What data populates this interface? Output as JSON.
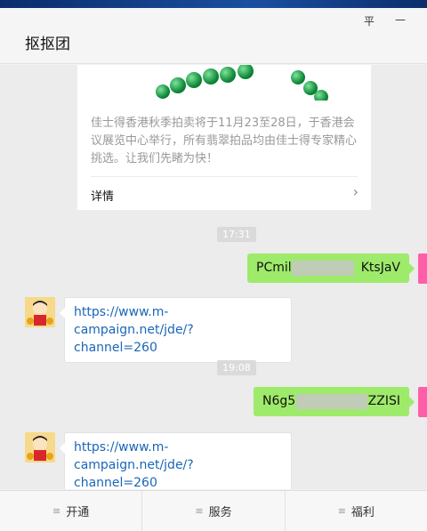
{
  "window": {
    "title": "抠抠团",
    "controls": {
      "pin": "平",
      "minimize": "—"
    }
  },
  "card": {
    "description": "佳士得香港秋季拍卖将于11月23至28日，于香港会议展览中心举行，所有翡翠拍品均由佳士得专家精心挑选。让我们先睹为快！",
    "detail_label": "详情",
    "arrow": "›"
  },
  "messages": [
    {
      "type": "time",
      "text": "17:31"
    },
    {
      "type": "outgoing",
      "text_start": "PCmil",
      "text_end": "KtsJaV"
    },
    {
      "type": "incoming",
      "line1": "https://www.m-campaign.net/jde/?",
      "line2": "channel=260"
    },
    {
      "type": "time",
      "text": "19:08"
    },
    {
      "type": "outgoing",
      "text_start": "N6g5",
      "text_end": "ZZISI"
    },
    {
      "type": "incoming",
      "line1": "https://www.m-campaign.net/jde/?",
      "line2": "channel=260"
    }
  ],
  "menu": [
    {
      "icon": "≡",
      "label": "开通"
    },
    {
      "icon": "≡",
      "label": "服务"
    },
    {
      "icon": "≡",
      "label": "福利"
    }
  ],
  "colors": {
    "outgoing_bubble": "#9eea6a",
    "link": "#1a66b8",
    "background": "#ececec"
  }
}
